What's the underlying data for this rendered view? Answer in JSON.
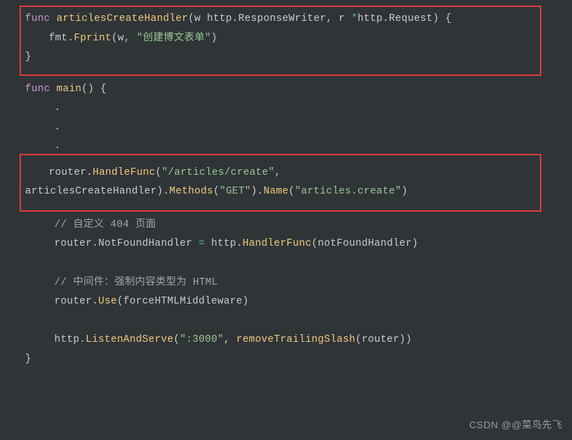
{
  "block1": {
    "l1": {
      "a": "func ",
      "b": "articlesCreateHandler",
      "c": "(w http.ResponseWriter, r ",
      "d": "*",
      "e": "http.Request) {"
    },
    "l2": {
      "a": "fmt.",
      "b": "Fprint",
      "c": "(w, ",
      "d": "\"创建博文表单\"",
      "e": ")"
    },
    "l3": "}"
  },
  "mainhead": {
    "a": "func ",
    "b": "main",
    "c": "() {"
  },
  "dot": ".",
  "block2": {
    "l1": {
      "a": "router.",
      "b": "HandleFunc",
      "c": "(",
      "d": "\"/articles/create\"",
      "e": ","
    },
    "l2": {
      "a": "articlesCreateHandler).",
      "b": "Methods",
      "c": "(",
      "d": "\"GET\"",
      "e": ").",
      "f": "Name",
      "g": "(",
      "h": "\"articles.create\"",
      "i": ")"
    }
  },
  "cmt1": "// 自定义 404 页面",
  "nf": {
    "a": "router.NotFoundHandler ",
    "b": "=",
    "c": " http.",
    "d": "HandlerFunc",
    "e": "(notFoundHandler)"
  },
  "cmt2": "// 中间件：强制内容类型为 HTML",
  "use": {
    "a": "router.",
    "b": "Use",
    "c": "(forceHTMLMiddleware)"
  },
  "serve": {
    "a": "http.",
    "b": "ListenAndServe",
    "c": "(",
    "d": "\":3000\"",
    "e": ", ",
    "f": "removeTrailingSlash",
    "g": "(router))"
  },
  "close": "}",
  "watermark": "CSDN @@菜鸟先飞"
}
